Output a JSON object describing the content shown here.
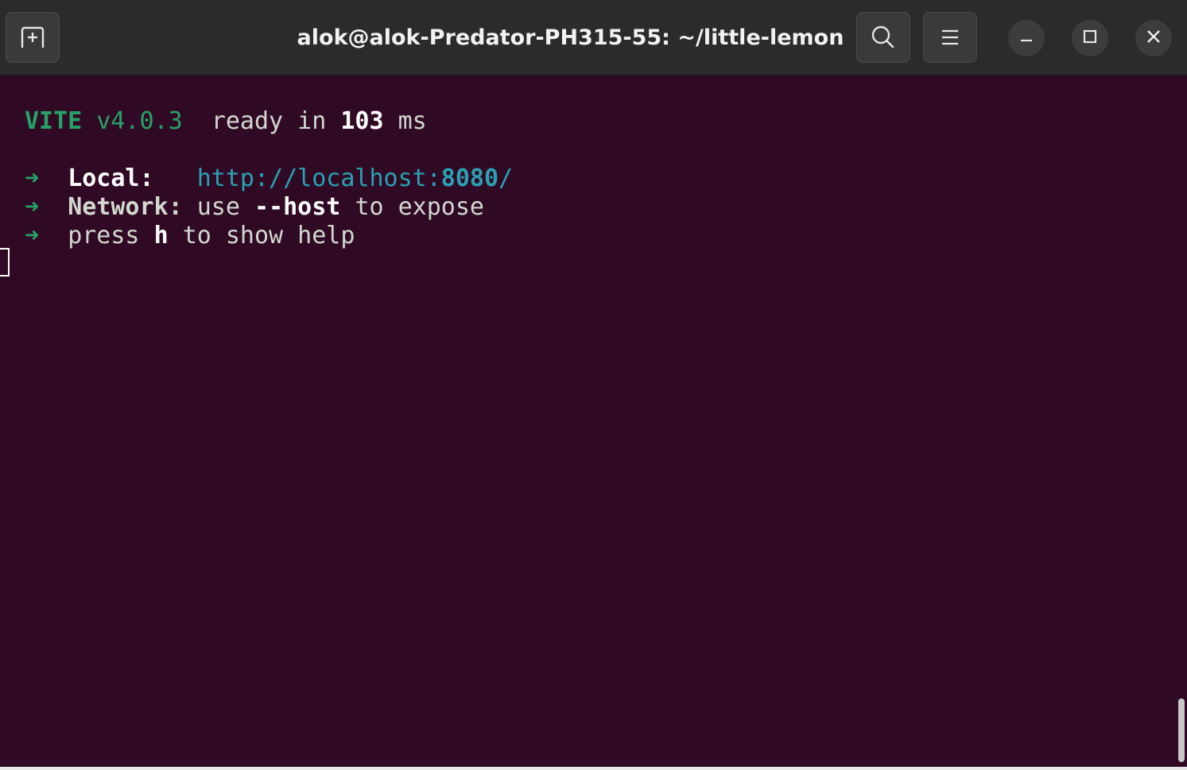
{
  "window": {
    "title": "alok@alok-Predator-PH315-55: ~/little-lemon"
  },
  "toolbar": {
    "new_tab_icon": "new-tab-icon",
    "search_icon": "search-icon",
    "menu_icon": "hamburger-menu-icon",
    "minimize_icon": "minimize-icon",
    "maximize_icon": "maximize-icon",
    "close_icon": "close-icon"
  },
  "terminal": {
    "line1": {
      "name": "VITE",
      "version": "v4.0.3",
      "ready_text": "ready in",
      "ready_ms": "103",
      "ms_unit": "ms"
    },
    "local": {
      "arrow": "➜",
      "label": "Local:",
      "url_prefix": "http://localhost:",
      "url_port": "8080",
      "url_suffix": "/"
    },
    "network": {
      "arrow": "➜",
      "label": "Network:",
      "text_use": "use",
      "flag": "--host",
      "text_rest": "to expose"
    },
    "help": {
      "arrow": "➜",
      "text_press": "press",
      "key": "h",
      "text_rest": "to show help"
    }
  },
  "colors": {
    "background": "#300a24",
    "titlebar": "#2b2b2b",
    "green": "#26a269",
    "cyan": "#2aa1b3",
    "text": "#d3d7cf"
  }
}
